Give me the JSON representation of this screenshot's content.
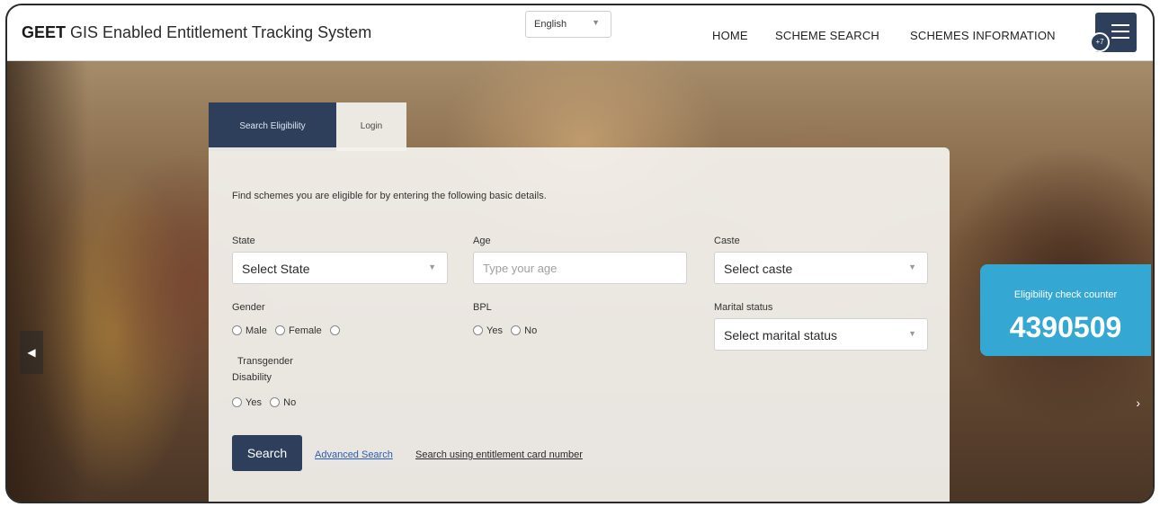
{
  "header": {
    "brand_bold": "GEET",
    "brand_rest": "GIS Enabled Entitlement Tracking System",
    "language": "English",
    "nav": [
      "HOME",
      "SCHEME SEARCH",
      "SCHEMES INFORMATION"
    ],
    "menu_badge": "+7"
  },
  "tabs": {
    "search": "Search Eligibility",
    "login": "Login"
  },
  "form": {
    "intro": "Find schemes you are eligible for by entering the following basic details.",
    "state_label": "State",
    "state_value": "Select State",
    "age_label": "Age",
    "age_placeholder": "Type your age",
    "caste_label": "Caste",
    "caste_value": "Select caste",
    "gender_label": "Gender",
    "gender_options": [
      "Male",
      "Female",
      "Transgender"
    ],
    "bpl_label": "BPL",
    "bpl_options": [
      "Yes",
      "No"
    ],
    "marital_label": "Marital status",
    "marital_value": "Select marital status",
    "disability_label": "Disability",
    "disability_options": [
      "Yes",
      "No"
    ],
    "search_button": "Search",
    "advanced_link": "Advanced Search",
    "card_link": "Search using entitlement card number"
  },
  "counter": {
    "label": "Eligibility check counter",
    "value": "4390509"
  },
  "colors": {
    "navy": "#2e3f5c",
    "counter_blue": "#34a8d3",
    "link_blue": "#2a5db0"
  }
}
